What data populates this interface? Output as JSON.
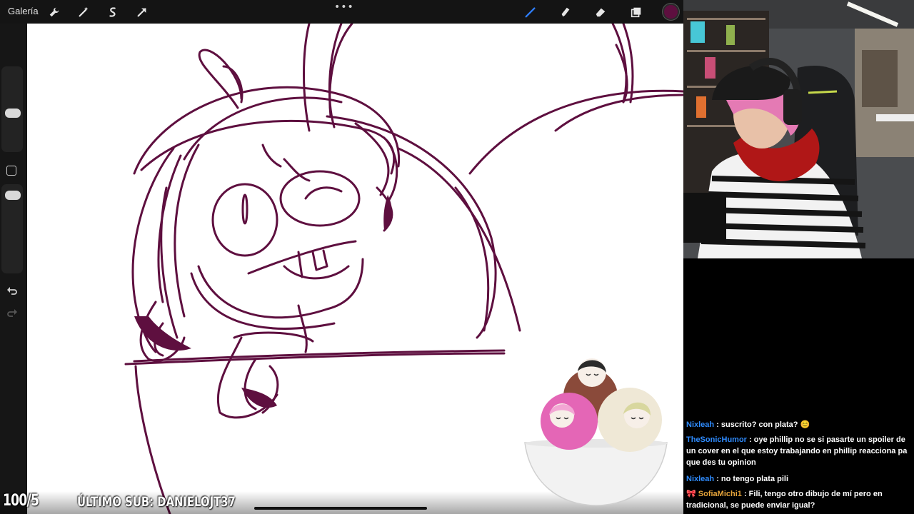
{
  "app": {
    "gallery_label": "Galería",
    "tools": [
      "wrench-icon",
      "magic-wand-icon",
      "selection-icon",
      "transform-arrow-icon"
    ],
    "right_tools": [
      "brush-icon",
      "smudge-icon",
      "eraser-icon",
      "layers-icon"
    ],
    "more_dots": "•••",
    "current_color": "#5e0f3f"
  },
  "overlay": {
    "sub_goal": "100/5",
    "last_sub": "ÚLTIMO SUB: DANIELOJT37"
  },
  "chat": {
    "messages": [
      {
        "user": "Nixleah",
        "text": ": suscrito? con plata? 😊"
      },
      {
        "user": "TheSonicHumor",
        "text": ": oye phillip no se si pasarte un spoiler de un cover en el que estoy trabajando en phillip reacciona pa que des tu opinion"
      },
      {
        "user": "Nixleah",
        "text": ": no tengo plata pili"
      },
      {
        "user": "SofiaMichi1",
        "badge": "🎀",
        "text": ": Fili, tengo otro dibujo de mí pero en tradicional, se puede enviar igual?"
      }
    ]
  },
  "colors": {
    "ink": "#5e0f3f",
    "chat_user": "#2f8cff",
    "chat_user_alt": "#e6a43a"
  }
}
